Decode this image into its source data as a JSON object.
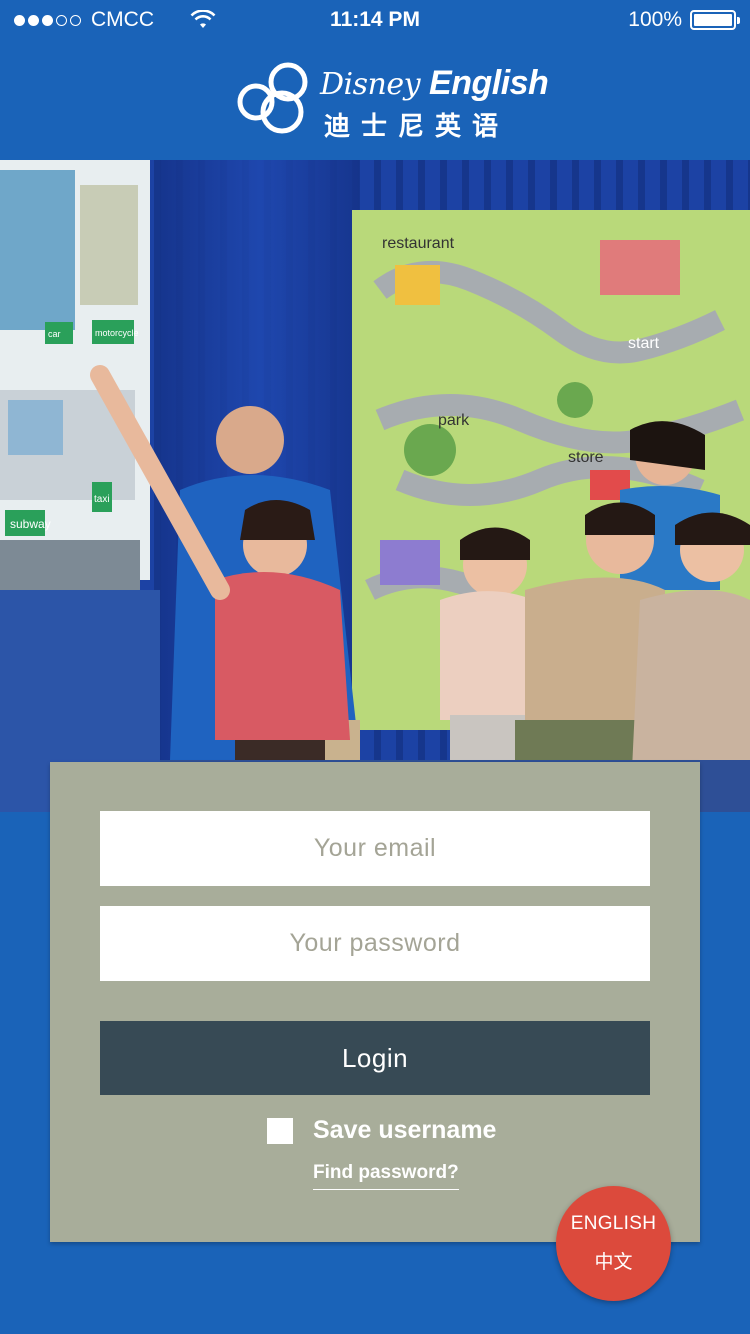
{
  "status_bar": {
    "carrier": "CMCC",
    "signal_bars_filled": 3,
    "signal_bars_total": 5,
    "time": "11:14 PM",
    "battery_percent": "100%",
    "battery_level": 1.0
  },
  "header": {
    "logo_brand": "Disney",
    "logo_product": "English",
    "logo_cn": "迪士尼英语"
  },
  "hero": {
    "sign_labels": {
      "restaurant": "restaurant",
      "park": "park",
      "store": "store",
      "start": "start",
      "subway": "subway",
      "taxi": "taxi",
      "motorcycle": "motorcycle",
      "car": "car"
    }
  },
  "login": {
    "email_placeholder": "Your email",
    "password_placeholder": "Your password",
    "login_label": "Login",
    "save_username_label": "Save username",
    "find_password_label": "Find password?"
  },
  "language_toggle": {
    "english_label": "ENGLISH",
    "chinese_label": "中文"
  },
  "colors": {
    "background": "#1a63b8",
    "panel": "#a8ad9a",
    "login_button": "#374a55",
    "language_button": "#dc4a3c"
  }
}
